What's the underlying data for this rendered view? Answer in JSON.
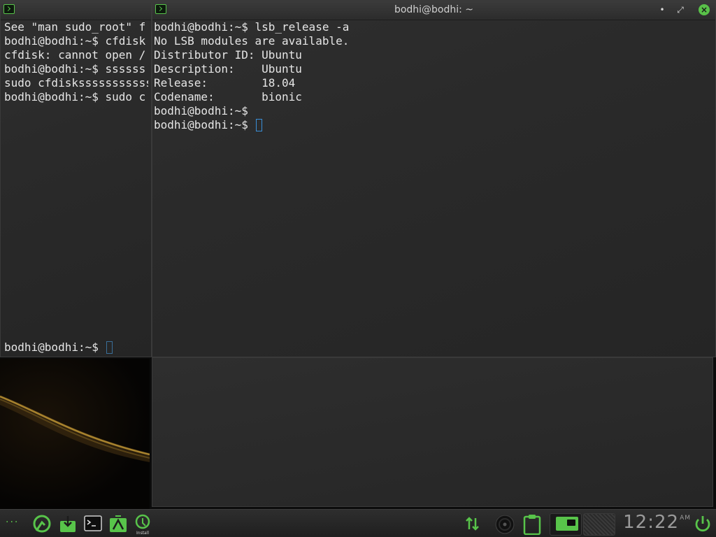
{
  "colors": {
    "accent": "#58c44a",
    "cursor": "#3a8fd8",
    "terminal_bg": "#2a2a2a",
    "text": "#e6e6e6"
  },
  "left_terminal": {
    "lines": [
      "See \"man sudo_root\" f",
      "",
      "bodhi@bodhi:~$ cfdisk",
      "cfdisk: cannot open /",
      "bodhi@bodhi:~$ ssssss",
      "sudo cfdisksssssssssss",
      "bodhi@bodhi:~$ sudo c"
    ],
    "prompt": "bodhi@bodhi:~$ "
  },
  "main_terminal": {
    "title": "bodhi@bodhi: ~",
    "lines": [
      "bodhi@bodhi:~$ lsb_release -a",
      "",
      "No LSB modules are available.",
      "Distributor ID: Ubuntu",
      "Description:    Ubuntu",
      "Release:        18.04",
      "Codename:       bionic",
      "bodhi@bodhi:~$"
    ],
    "prompt": "bodhi@bodhi:~$ ",
    "buttons": {
      "minimize": "•",
      "maximize": "⤢",
      "close": "×"
    }
  },
  "taskbar": {
    "menu_dots": "···",
    "launchers": [
      "bodhi-logo-icon",
      "download-icon",
      "terminal-icon",
      "app-center-icon",
      "install-icon"
    ],
    "install_label": "Install",
    "tray": [
      "network-icon",
      "disc-icon",
      "clipboard-icon",
      "desktop-1-icon",
      "desktop-2-icon"
    ],
    "clock_time": "12:22",
    "clock_ampm": "AM",
    "power_icon": "power-icon"
  }
}
